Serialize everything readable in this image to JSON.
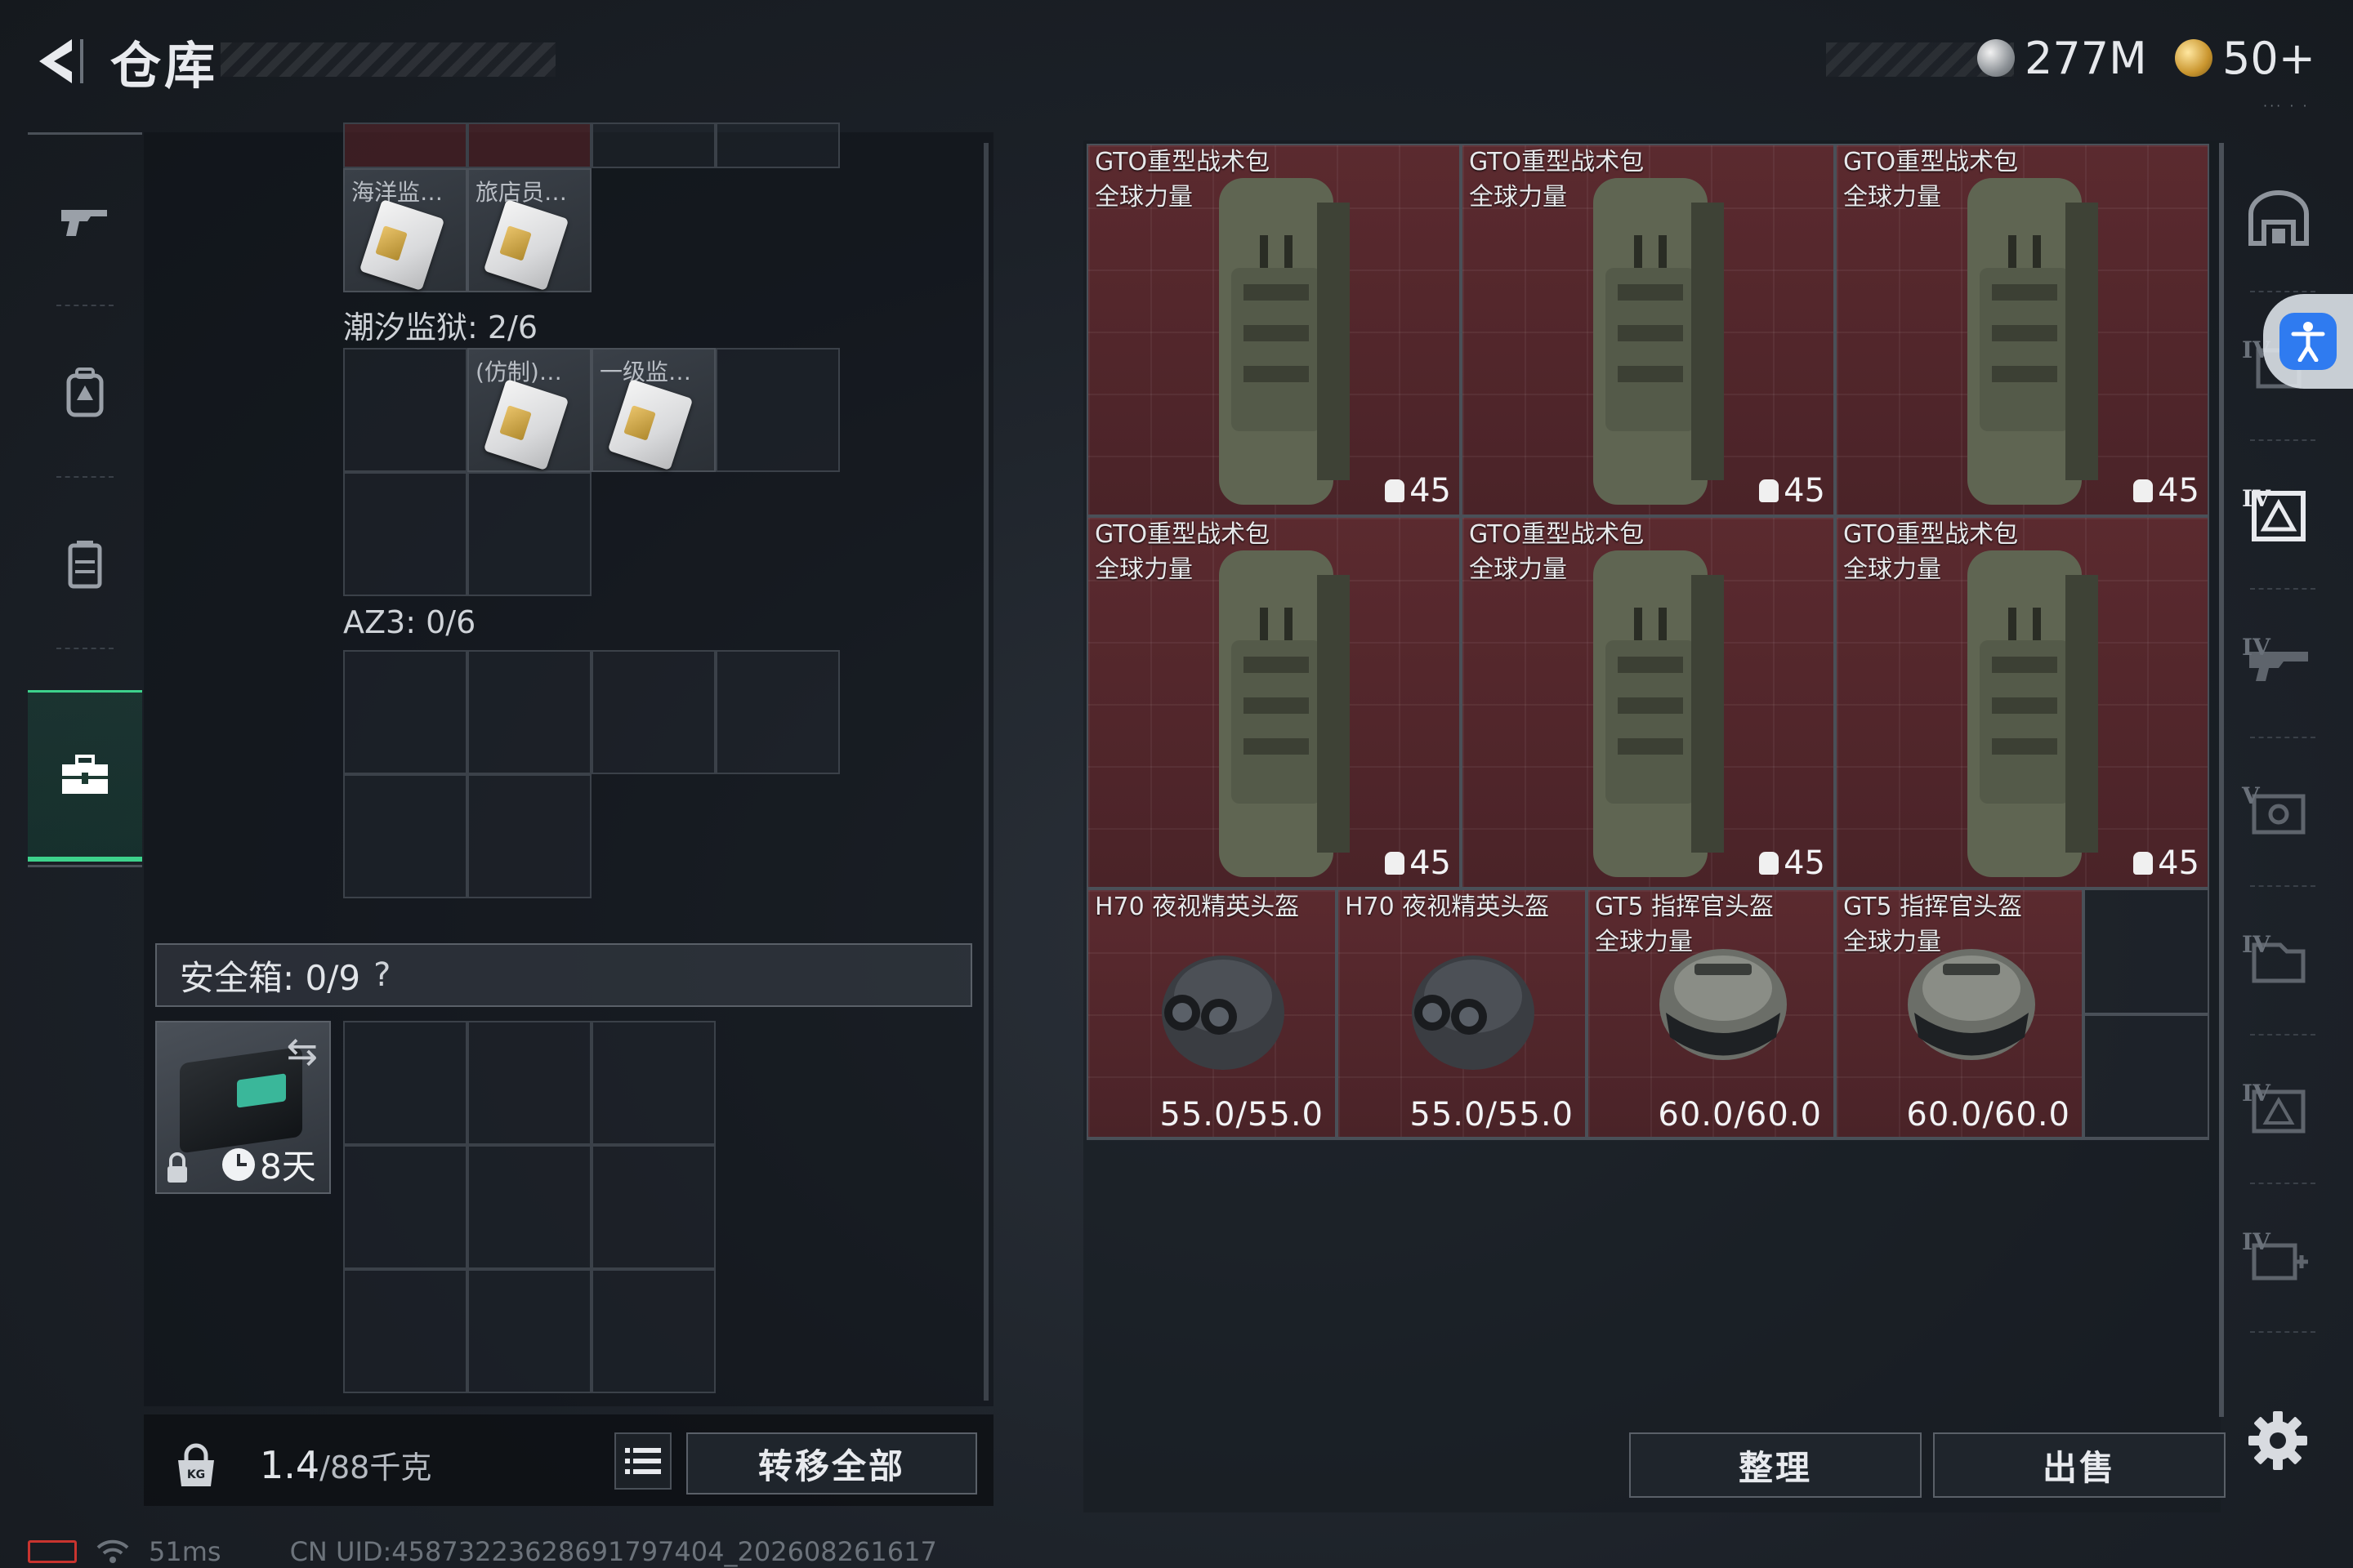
{
  "header": {
    "title": "仓库",
    "currency_silver": "277M",
    "currency_gold": "50+",
    "dots": "··· · ·"
  },
  "left_sidebar": {
    "items": [
      {
        "icon": "gun-icon"
      },
      {
        "icon": "backpack-icon"
      },
      {
        "icon": "vest-icon"
      },
      {
        "icon": "toolbox-icon",
        "active": true
      }
    ]
  },
  "containers": {
    "section1_items": [
      "海洋监…",
      "旅店员…"
    ],
    "section2_label": "潮汐监狱: 2/6",
    "section2_items": [
      "(仿制)…",
      "一级监…"
    ],
    "section3_label": "AZ3: 0/6"
  },
  "safe": {
    "label": "安全箱: 0/9",
    "help": "?",
    "timer": "8天"
  },
  "footer_left": {
    "weight_current": "1.4",
    "weight_capacity": "/88千克",
    "transfer_all": "转移全部"
  },
  "status_bar": {
    "ping": "51ms",
    "uid": "CN UID:45873223628691797404_202608261617"
  },
  "inventory": {
    "backpacks": [
      {
        "name": "GTO重型战术包",
        "sub": "全球力量",
        "count": "45"
      },
      {
        "name": "GTO重型战术包",
        "sub": "全球力量",
        "count": "45"
      },
      {
        "name": "GTO重型战术包",
        "sub": "全球力量",
        "count": "45"
      },
      {
        "name": "GTO重型战术包",
        "sub": "全球力量",
        "count": "45"
      },
      {
        "name": "GTO重型战术包",
        "sub": "全球力量",
        "count": "45"
      },
      {
        "name": "GTO重型战术包",
        "sub": "全球力量",
        "count": "45"
      }
    ],
    "helmets": [
      {
        "name": "H70 夜视精英头盔",
        "sub": "",
        "durability": "55.0/55.0"
      },
      {
        "name": "H70 夜视精英头盔",
        "sub": "",
        "durability": "55.0/55.0"
      },
      {
        "name": "GT5 指挥官头盔",
        "sub": "全球力量",
        "durability": "60.0/60.0"
      },
      {
        "name": "GT5 指挥官头盔",
        "sub": "全球力量",
        "durability": "60.0/60.0"
      }
    ]
  },
  "actions": {
    "sort": "整理",
    "sell": "出售"
  },
  "right_sidebar": {
    "tiers": [
      "",
      "IV",
      "IV",
      "IV",
      "V",
      "IV",
      "IV",
      "IV"
    ]
  },
  "colors": {
    "accent": "#3dd28c",
    "item_red": "#5b2a2f",
    "accessibility_blue": "#2f7bf0"
  }
}
